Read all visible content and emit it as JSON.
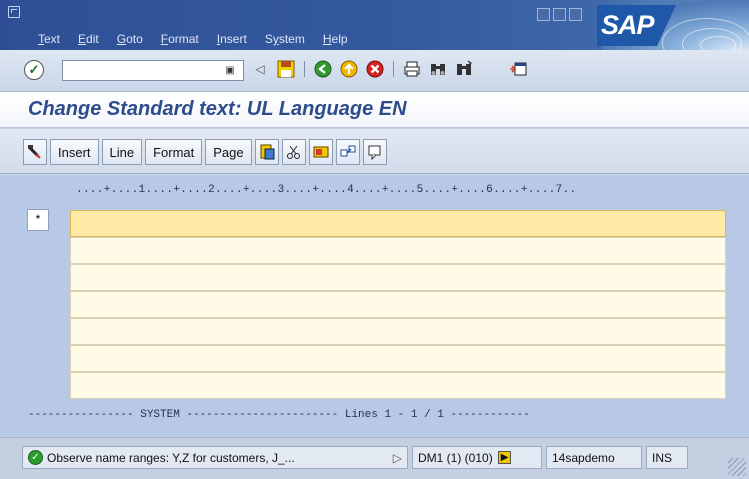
{
  "menubar": {
    "items": [
      {
        "label": "Text",
        "mn": "T"
      },
      {
        "label": "Edit",
        "mn": "E"
      },
      {
        "label": "Goto",
        "mn": "G"
      },
      {
        "label": "Format",
        "mn": "F"
      },
      {
        "label": "Insert",
        "mn": "I"
      },
      {
        "label": "System",
        "mn": "y"
      },
      {
        "label": "Help",
        "mn": "H"
      }
    ],
    "logo_text": "SAP"
  },
  "stdbar": {
    "command_value": "",
    "icons": [
      "back-icon",
      "save-icon",
      "green-back-icon",
      "exit-icon",
      "cancel-icon",
      "print-icon",
      "find-icon",
      "find-next-icon",
      "create-session-icon"
    ]
  },
  "title": "Change Standard text: UL Language EN",
  "apptoolbar": {
    "buttons": [
      "Insert",
      "Line",
      "Format",
      "Page"
    ]
  },
  "editor": {
    "ruler": "....+....1....+....2....+....3....+....4....+....5....+....6....+....7..",
    "para_format": "*",
    "line_count": 7,
    "footer": "---------------- SYSTEM ----------------------- Lines 1 - 1 / 1 ------------"
  },
  "status": {
    "message": "Observe name ranges: Y,Z for customers, J_...",
    "system": "DM1 (1) (010)",
    "server": "14sapdemo",
    "mode": "INS"
  }
}
